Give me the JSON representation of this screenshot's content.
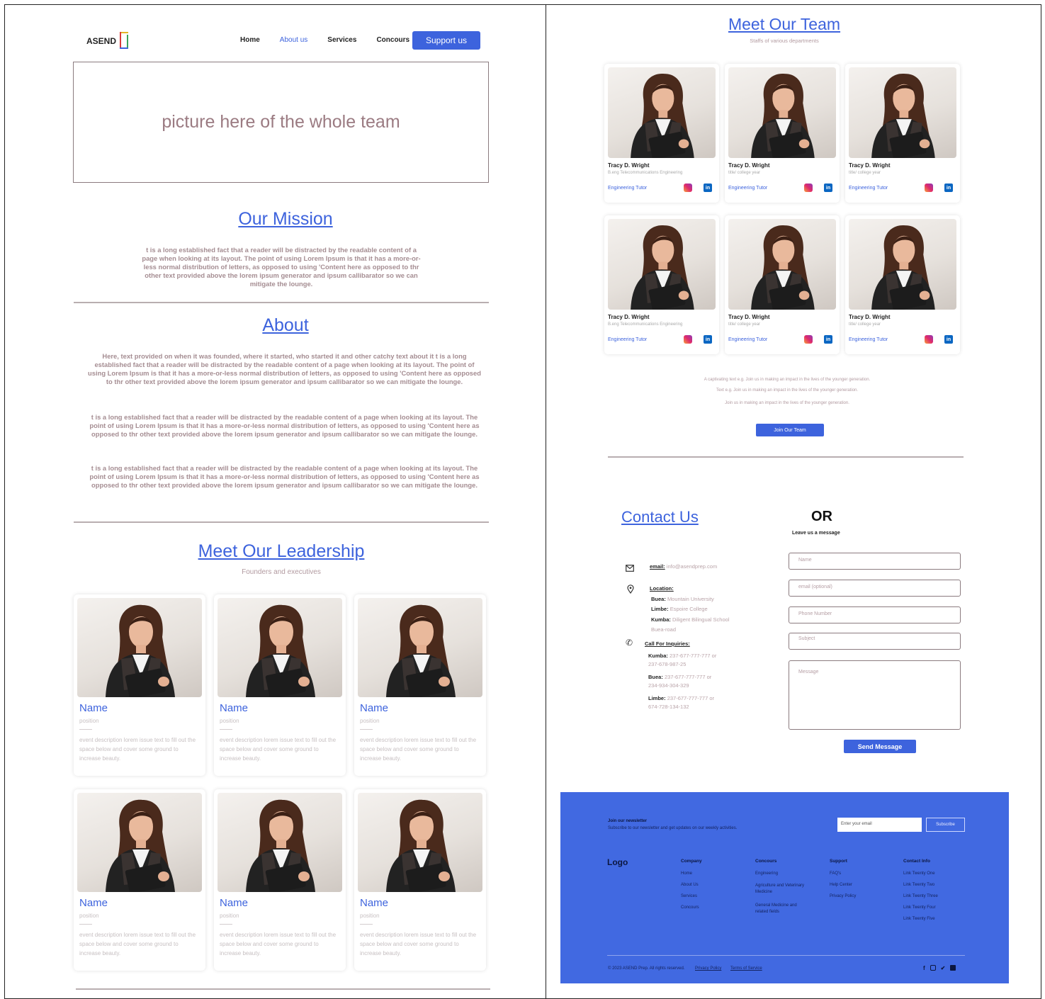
{
  "colors": {
    "accent": "#3d63dd",
    "footer_bg": "#4169e1",
    "muted_text": "#a58d92"
  },
  "left": {
    "logo_text": "ASEND",
    "nav": [
      "Home",
      "About us",
      "Services",
      "Concours"
    ],
    "nav_active": "About us",
    "support_button": "Support us",
    "hero_text": "picture here of the whole team",
    "mission": {
      "title": "Our Mission",
      "text": "t is a long established fact that a reader will be distracted by the readable content of a page when looking at its layout. The point of using Lorem Ipsum is that it has a more-or-less normal distribution of letters, as opposed to using 'Content here as opposed to thr other text provided above the lorem ipsum generator and ipsum callibarator so we can mitigate the lounge."
    },
    "about": {
      "title": "About",
      "p1": "Here, text provided on when it was founded, where it started, who started it and other catchy text about it  t is a long established fact that a reader will be distracted by the readable content of a page when looking at its layout. The point of using Lorem Ipsum is that it has a more-or-less normal distribution of letters, as opposed to using 'Content here as opposed to thr other text provided above the lorem ipsum generator and ipsum callibarator so we can mitigate the lounge.",
      "p2": "t is a long established fact that a reader will be distracted by the readable content of a page when looking at its layout. The point of using Lorem Ipsum is that it has a more-or-less normal distribution of letters, as opposed to using 'Content here as opposed to thr other text provided above the lorem ipsum generator and ipsum callibarator so we can mitigate the lounge.",
      "p3": "t is a long established fact that a reader will be distracted by the readable content of a page when looking at its layout. The point of using Lorem Ipsum is that it has a more-or-less normal distribution of letters, as opposed to using 'Content here as opposed to thr other text provided above the lorem ipsum generator and ipsum callibarator so we can mitigate the lounge."
    },
    "leadership": {
      "title": "Meet Our Leadership",
      "subtitle": "Founders and executives",
      "cards": [
        {
          "name": "Name",
          "position": "position",
          "desc": "event description lorem issue text to fill out the space below and cover some ground to increase beauty."
        },
        {
          "name": "Name",
          "position": "position",
          "desc": "event description lorem issue text to fill out the space below and cover some ground to increase beauty."
        },
        {
          "name": "Name",
          "position": "position",
          "desc": "event description lorem issue text to fill out the space below and cover some ground to increase beauty."
        },
        {
          "name": "Name",
          "position": "position",
          "desc": "event description lorem issue text to fill out the space below and cover some ground to increase beauty."
        },
        {
          "name": "Name",
          "position": "position",
          "desc": "event description lorem issue text to fill out the space below and cover some ground to increase beauty."
        },
        {
          "name": "Name",
          "position": "position",
          "desc": "event description lorem issue text to fill out the space below and cover some ground to increase beauty."
        }
      ]
    }
  },
  "right": {
    "team": {
      "title": "Meet Our Team",
      "subtitle": "Staffs of various departments",
      "cards": [
        {
          "name": "Tracy D. Wright",
          "sub": "B.eng Telecommunications Engineering",
          "role": "Engineering Tutor"
        },
        {
          "name": "Tracy D. Wright",
          "sub": "title/ college year",
          "role": "Engineering Tutor"
        },
        {
          "name": "Tracy D. Wright",
          "sub": "title/ college year",
          "role": "Engineering Tutor"
        },
        {
          "name": "Tracy D. Wright",
          "sub": "B.eng Telecommunications Engineering",
          "role": "Engineering Tutor"
        },
        {
          "name": "Tracy D. Wright",
          "sub": "title/ college year",
          "role": "Engineering Tutor"
        },
        {
          "name": "Tracy D. Wright",
          "sub": "title/ college year",
          "role": "Engineering Tutor"
        }
      ],
      "linkedin_label": "in",
      "cta_lines": [
        "A captivating text e.g. Join us in making an impact in the lives of the younger generation.",
        "Text e.g. Join us in making an impact in the lives of the younger generation.",
        "Join us in making an impact in the lives of the younger generation."
      ],
      "join_button": "Join Our Team"
    },
    "contact": {
      "title": "Contact Us",
      "or": "OR",
      "leave_message": "Leave us a message",
      "email_label": "email:",
      "email_value": "info@asendprep.com",
      "location_label": "Location:",
      "locations": [
        {
          "city": "Buea:",
          "place": "Mountain University"
        },
        {
          "city": "Limbe:",
          "place": "Espoire College"
        },
        {
          "city": "Kumba:",
          "place": "Diligent Bilingual School"
        }
      ],
      "location_extra": "Buea-road",
      "call_label": "Call For Inquiries:",
      "calls": [
        {
          "city": "Kumba:",
          "numbers": "237-677-777-777 or",
          "more": "237-678-987-25"
        },
        {
          "city": "Buea:",
          "numbers": "237-677-777-777 or",
          "more": "234-934-304-329"
        },
        {
          "city": "Limbe:",
          "numbers": "237-677-777-777 or",
          "more": "674-728-134-132"
        }
      ],
      "fields": {
        "name": "Name",
        "email": "email (optional)",
        "phone": "Phone Number",
        "subject": "Subject",
        "message": "Message"
      },
      "send_button": "Send Message"
    },
    "footer": {
      "newsletter_title": "Join our newsletter",
      "newsletter_text": "Subscribe to our newsletter and get updates on our weekly activities.",
      "email_placeholder": "Enter your email",
      "subscribe": "Subscribe",
      "logo": "Logo",
      "columns": [
        {
          "title": "Company",
          "links": [
            "Home",
            "About Us",
            "Services",
            "Concours"
          ]
        },
        {
          "title": "Concours",
          "links": [
            "Engineering",
            "Agriculture and Veterinary Medicine",
            "General Medicine and related fields"
          ]
        },
        {
          "title": "Support",
          "links": [
            "FAQ's",
            "Help Center",
            "Privacy Policy"
          ]
        },
        {
          "title": "Contact Info",
          "links": [
            "Link Twenty One",
            "Link Twenty Two",
            "Link Twenty Three",
            "Link Twenty Four",
            "Link Twenty Five"
          ]
        }
      ],
      "copyright": "© 2023 ASEND Prep. All rights reserved.",
      "privacy": "Privacy Policy",
      "terms": "Terms of Service"
    }
  }
}
